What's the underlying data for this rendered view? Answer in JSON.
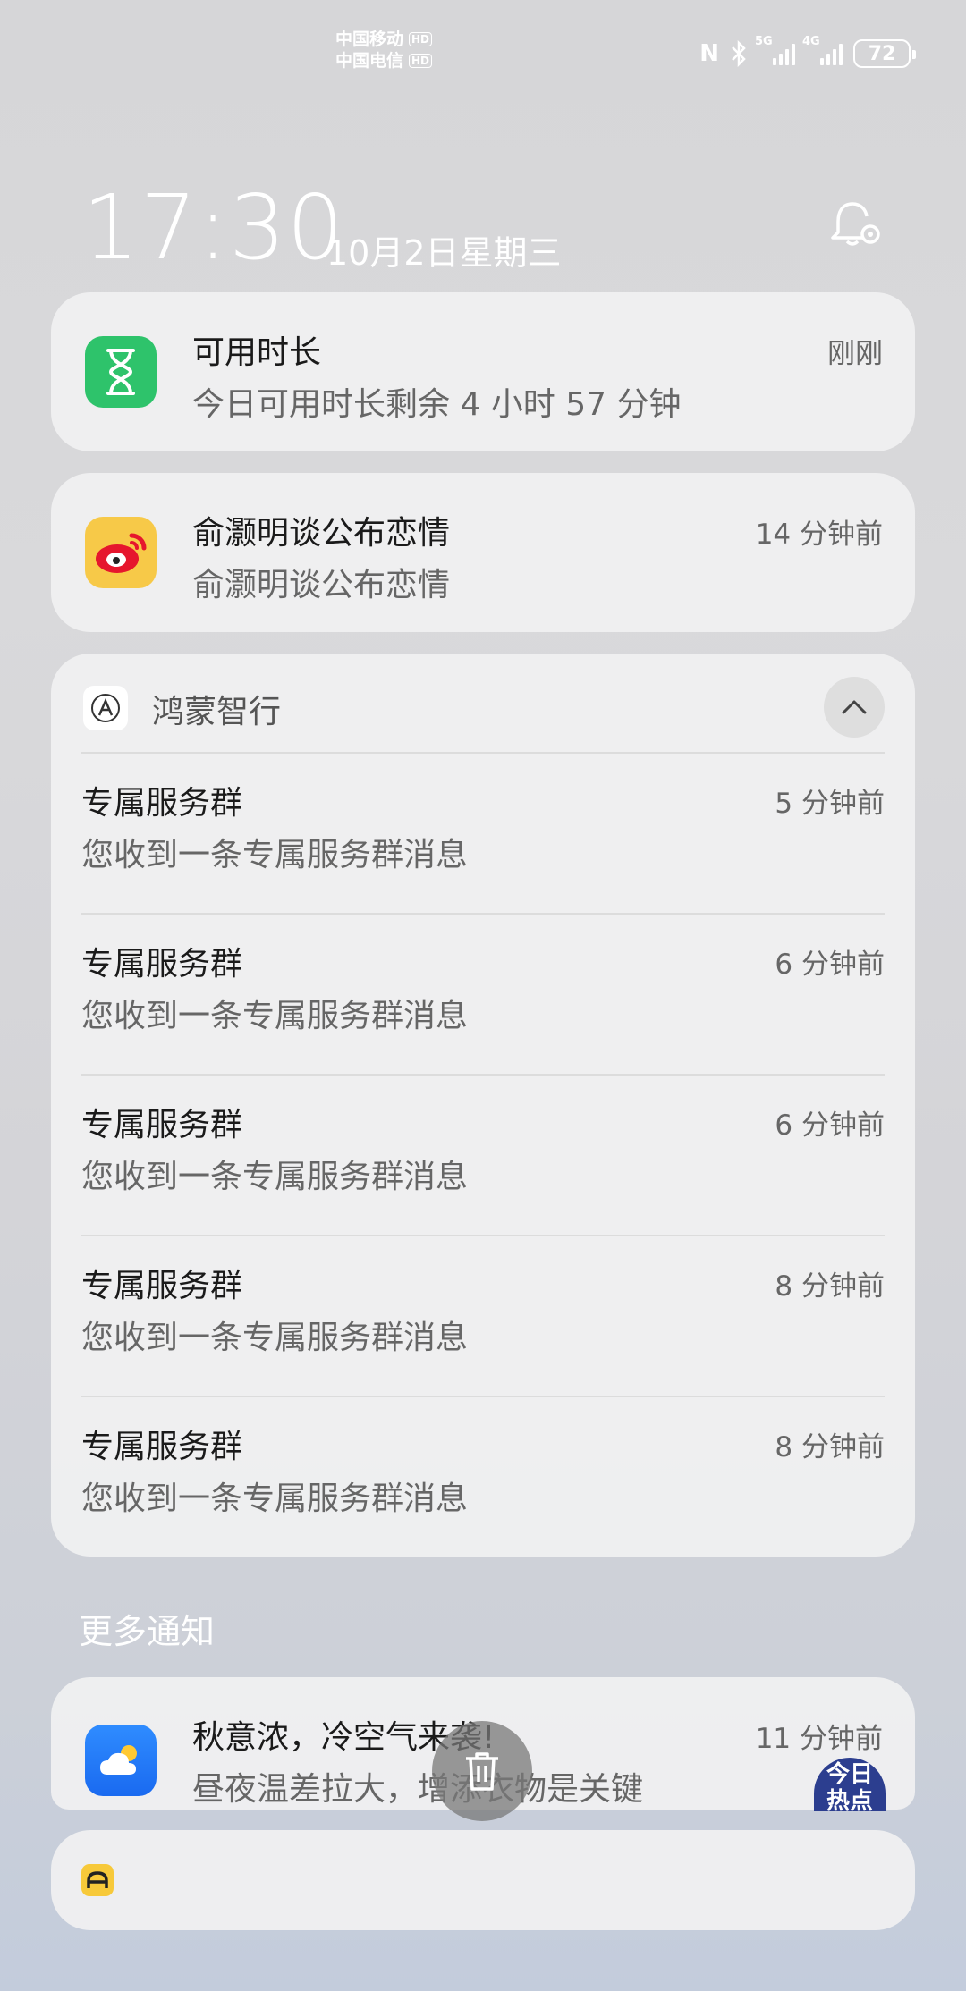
{
  "status_bar": {
    "carrier1": "中国移动",
    "carrier2": "中国电信",
    "hd": "HD",
    "net1": "5G",
    "net2": "4G",
    "battery": "72"
  },
  "lock": {
    "time": "17:30",
    "date": "10月2日星期三"
  },
  "notifications": [
    {
      "app_icon": "hourglass-icon",
      "title": "可用时长",
      "body": "今日可用时长剩余 4 小时 57 分钟",
      "time": "刚刚",
      "icon_color": "#2ec36b"
    },
    {
      "app_icon": "weibo-icon",
      "title": "俞灏明谈公布恋情",
      "body": "俞灏明谈公布恋情",
      "time": "14 分钟前",
      "icon_color": "#f7c948"
    }
  ],
  "group": {
    "app_name": "鸿蒙智行",
    "items": [
      {
        "title": "专属服务群",
        "body": "您收到一条专属服务群消息",
        "time": "5 分钟前"
      },
      {
        "title": "专属服务群",
        "body": "您收到一条专属服务群消息",
        "time": "6 分钟前"
      },
      {
        "title": "专属服务群",
        "body": "您收到一条专属服务群消息",
        "time": "6 分钟前"
      },
      {
        "title": "专属服务群",
        "body": "您收到一条专属服务群消息",
        "time": "8 分钟前"
      },
      {
        "title": "专属服务群",
        "body": "您收到一条专属服务群消息",
        "time": "8 分钟前"
      }
    ]
  },
  "more_label": "更多通知",
  "weather": {
    "title": "秋意浓，冷空气来袭!",
    "body": "昼夜温差拉大，增添衣物是关键",
    "time": "11 分钟前",
    "badge": "今日\n热点"
  }
}
